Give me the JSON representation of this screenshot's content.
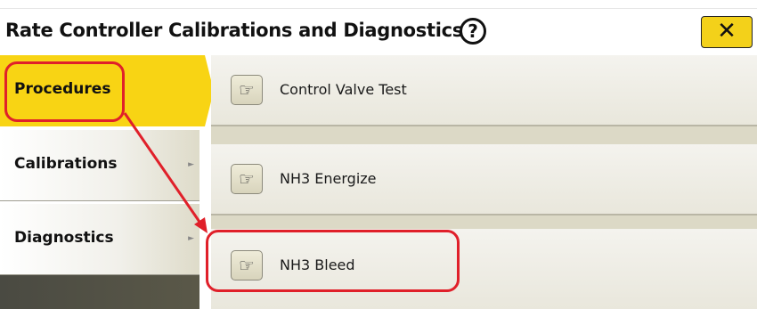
{
  "header": {
    "title": "Rate Controller Calibrations and Diagnostics",
    "help_symbol": "?",
    "close_symbol": "✕"
  },
  "sidebar": {
    "items": [
      {
        "label": "Procedures",
        "active": true
      },
      {
        "label": "Calibrations",
        "active": false,
        "arrow": "►"
      },
      {
        "label": "Diagnostics",
        "active": false,
        "arrow": "►"
      }
    ]
  },
  "procedures": {
    "items": [
      {
        "label": "Control Valve Test",
        "icon": "hand-pointer-icon"
      },
      {
        "label": "NH3 Energize",
        "icon": "hand-pointer-icon"
      },
      {
        "label": "NH3 Bleed",
        "icon": "hand-pointer-icon"
      }
    ],
    "hand_symbol": "☞"
  },
  "colors": {
    "accent": "#f8d414",
    "annotation": "#e0202a"
  }
}
